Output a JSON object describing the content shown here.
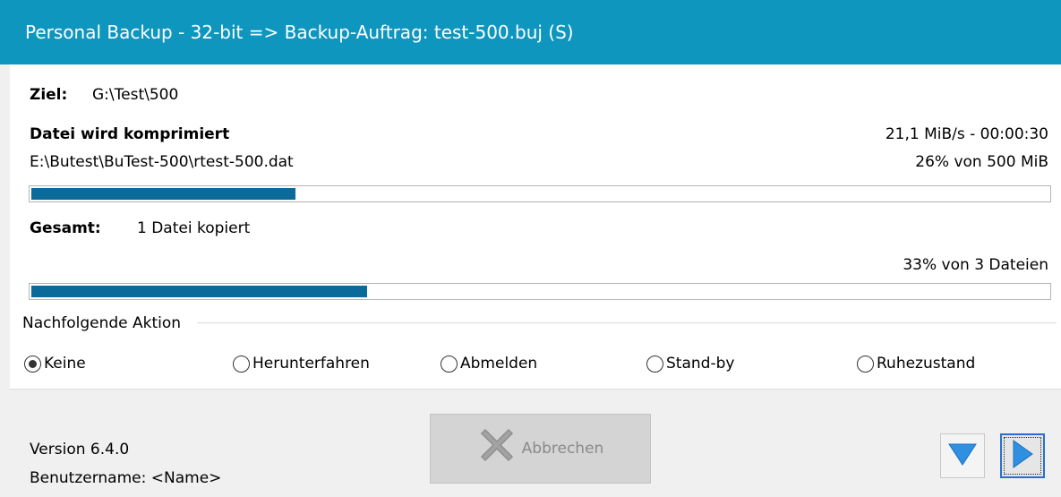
{
  "window": {
    "title": "Personal Backup - 32-bit => Backup-Auftrag: test-500.buj (S)"
  },
  "target": {
    "label": "Ziel:",
    "value": "G:\\Test\\500"
  },
  "file": {
    "status": "Datei wird komprimiert",
    "path": "E:\\Butest\\BuTest-500\\rtest-500.dat",
    "speed": "21,1 MiB/s - 00:00:30",
    "progress_text": "26% von 500 MiB",
    "progress_percent": 26
  },
  "total": {
    "label": "Gesamt:",
    "value": "1 Datei kopiert",
    "progress_text": "33% von 3 Dateien",
    "progress_percent": 33
  },
  "action": {
    "group_label": "Nachfolgende Aktion",
    "options": [
      "Keine",
      "Herunterfahren",
      "Abmelden",
      "Stand-by",
      "Ruhezustand"
    ],
    "selected": "Keine"
  },
  "footer": {
    "version": "Version 6.4.0",
    "user": "Benutzername: <Name>",
    "cancel_label": "Abbrechen"
  },
  "colors": {
    "titlebar": "#0e96bf",
    "progress_fill": "#0a6a9a",
    "nav_icon": "#2f8fe0"
  },
  "icons": {
    "cancel": "x-icon",
    "nav_down": "triangle-down-icon",
    "nav_play": "play-icon"
  }
}
